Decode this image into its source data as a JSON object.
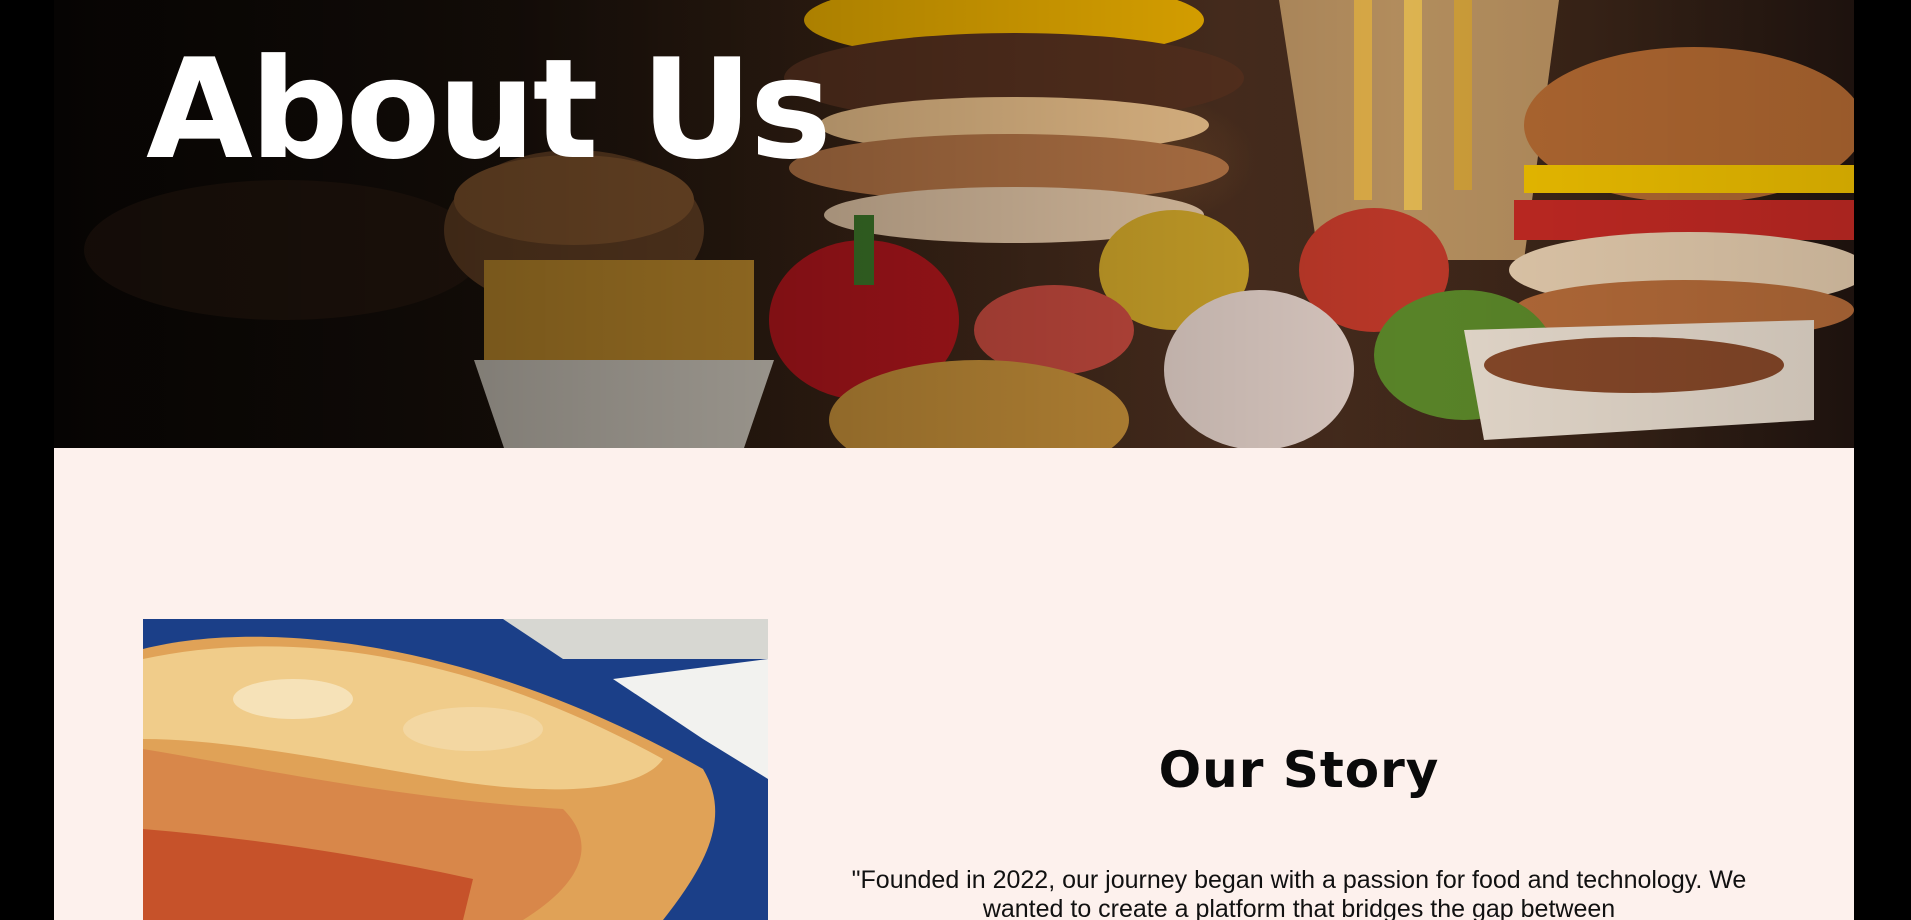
{
  "hero": {
    "title": "About Us",
    "image": "fast-food-spread-photo"
  },
  "story": {
    "heading": "Our Story",
    "image": "lasagna-photo",
    "text": "\"Founded in 2022, our journey began with a passion for food and technology. We wanted to create a platform that bridges the gap between"
  },
  "colors": {
    "page_background": "#fdf1ed",
    "frame": "#000000",
    "hero_text": "#ffffff",
    "body_text": "#111111",
    "plate_blue": "#1b3f88"
  }
}
